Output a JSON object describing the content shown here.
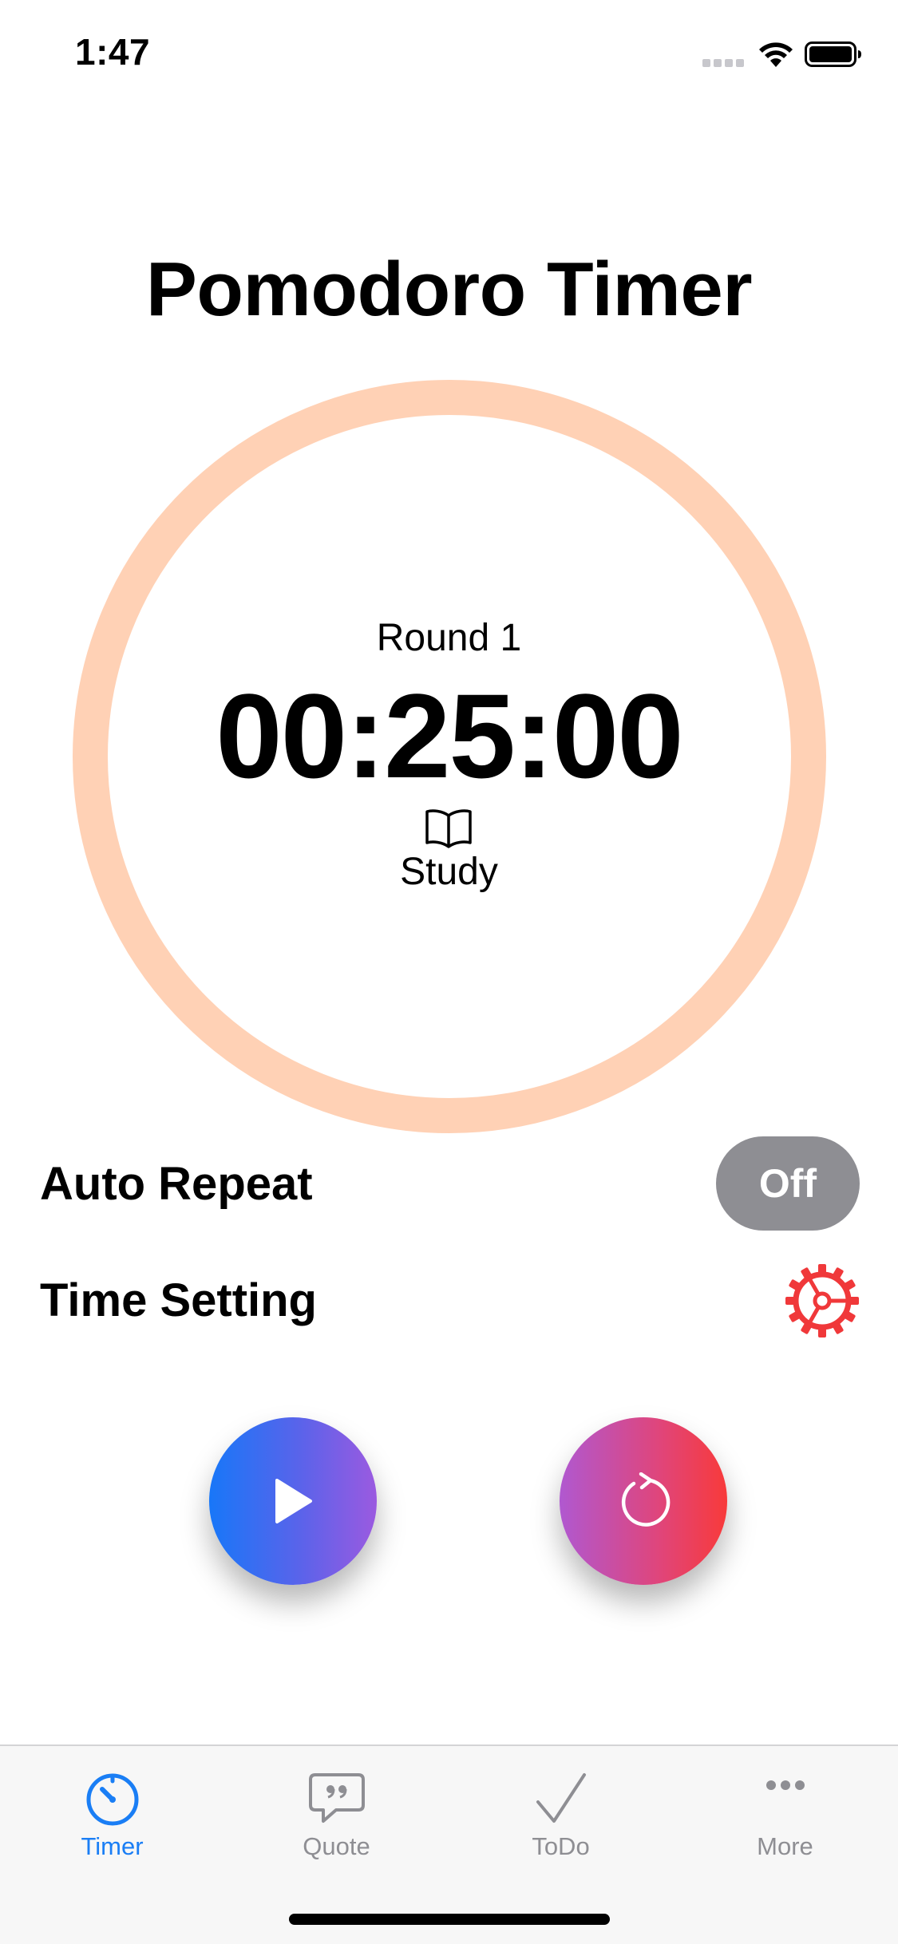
{
  "status_bar": {
    "time": "1:47"
  },
  "title": "Pomodoro Timer",
  "timer": {
    "round_label": "Round 1",
    "time": "00:25:00",
    "mode": "Study",
    "mode_icon": "book-icon",
    "progress": 0,
    "ring_color": "#ffd1b5"
  },
  "settings": {
    "auto_repeat": {
      "label": "Auto Repeat",
      "toggle_value": "Off"
    },
    "time_setting": {
      "label": "Time Setting",
      "icon": "gear-icon",
      "icon_color": "#f0383a"
    }
  },
  "controls": {
    "play_icon": "play-icon",
    "reset_icon": "reset-icon"
  },
  "tab_bar": {
    "active_color": "#1a7ef5",
    "inactive_color": "#8e8e93",
    "tabs": [
      {
        "label": "Timer",
        "icon": "stopwatch-icon",
        "active": true
      },
      {
        "label": "Quote",
        "icon": "quote-bubble-icon",
        "active": false
      },
      {
        "label": "ToDo",
        "icon": "checkmark-icon",
        "active": false
      },
      {
        "label": "More",
        "icon": "more-icon",
        "active": false
      }
    ]
  }
}
